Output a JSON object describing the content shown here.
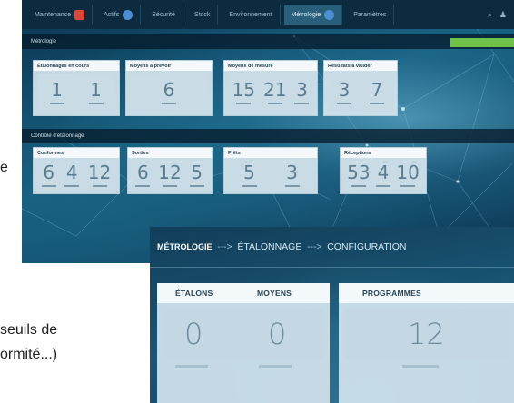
{
  "page": {
    "left_fragment": "e",
    "bottom_line1": "seuils de",
    "bottom_line2": "ormité...)"
  },
  "dashboard": {
    "nav": [
      {
        "label": "Maintenance",
        "icon": "home-icon",
        "badge": "red"
      },
      {
        "label": "Actifs",
        "icon": "tools-icon",
        "badge": "blue"
      },
      {
        "label": "Sécurité",
        "icon": "shield-icon"
      },
      {
        "label": "Stock",
        "icon": "box-icon"
      },
      {
        "label": "Environnement",
        "icon": "leaf-icon"
      },
      {
        "label": "Métrologie",
        "icon": "gauge-icon",
        "badge": "blue",
        "active": true
      },
      {
        "label": "Paramètres",
        "icon": "settings-icon"
      }
    ],
    "section1": "Métrologie",
    "section2": "Contrôle d'étalonnage",
    "cards_row1": [
      {
        "title": "Étalonnages en cours",
        "values": [
          "1",
          "1"
        ]
      },
      {
        "title": "Moyens à prévoir",
        "values": [
          "6"
        ]
      },
      {
        "title": "Moyens de mesure",
        "values": [
          "15",
          "21",
          "3"
        ]
      },
      {
        "title": "Résultats à valider",
        "values": [
          "3",
          "7"
        ]
      }
    ],
    "cards_row2": [
      {
        "title": "Conformes",
        "values": [
          "6",
          "4",
          "12"
        ]
      },
      {
        "title": "Sorties",
        "values": [
          "6",
          "12",
          "5"
        ]
      },
      {
        "title": "Prêts",
        "values": [
          "5",
          "3"
        ]
      },
      {
        "title": "Réceptions",
        "values": [
          "53",
          "4",
          "10"
        ]
      }
    ]
  },
  "zoom": {
    "crumb1": "MÉTROLOGIE",
    "sep1": "--->",
    "crumb2": "ÉTALONNAGE",
    "sep2": "--->",
    "crumb3": "CONFIGURATION",
    "etalons_label": "ÉTALONS",
    "etalons_value": "0",
    "moyens_label": "MOYENS",
    "moyens_value": "0",
    "programmes_label": "PROGRAMMES",
    "programmes_value": "12"
  }
}
